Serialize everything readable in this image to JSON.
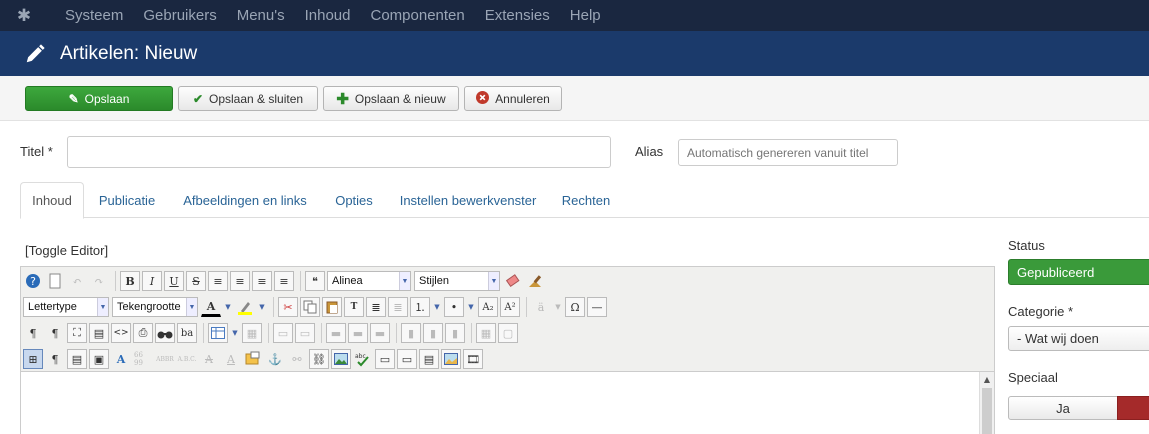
{
  "topnav": {
    "logo_icon": "joomla-icon",
    "items": [
      "Systeem",
      "Gebruikers",
      "Menu's",
      "Inhoud",
      "Componenten",
      "Extensies",
      "Help"
    ]
  },
  "header": {
    "title": "Artikelen: Nieuw",
    "icon": "pencil-icon"
  },
  "toolbar": {
    "save_label": "Opslaan",
    "save_close_label": "Opslaan & sluiten",
    "save_new_label": "Opslaan & nieuw",
    "cancel_label": "Annuleren"
  },
  "form": {
    "title_label": "Titel *",
    "title_value": "",
    "alias_label": "Alias",
    "alias_placeholder": "Automatisch genereren vanuit titel"
  },
  "tabs": [
    "Inhoud",
    "Publicatie",
    "Afbeeldingen en links",
    "Opties",
    "Instellen bewerkvenster",
    "Rechten"
  ],
  "active_tab": "Inhoud",
  "editor": {
    "toggle_label": "[Toggle Editor]",
    "format_select": "Alinea",
    "styles_select": "Stijlen",
    "font_select": "Lettertype",
    "size_select": "Tekengrootte"
  },
  "sidebar": {
    "status_label": "Status",
    "status_value": "Gepubliceerd",
    "category_label": "Categorie *",
    "category_value": "- Wat wij doen",
    "featured_label": "Speciaal",
    "featured_yes": "Ja"
  },
  "colors": {
    "topnav_bg": "#1a2740",
    "titlebar_bg": "#1b3a6b",
    "save_green": "#2b8a2b",
    "status_green": "#3a9a3a",
    "featured_no_red": "#a52a2a"
  }
}
